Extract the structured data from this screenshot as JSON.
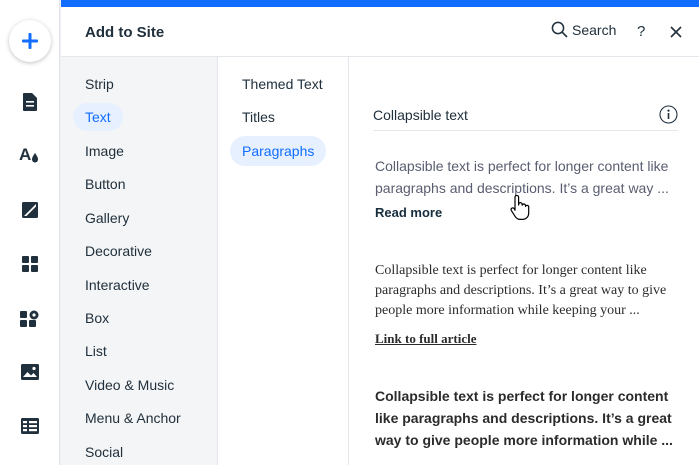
{
  "colors": {
    "accent": "#116dff",
    "active_bg": "#e7f0ff",
    "text": "#20303c"
  },
  "rail": {
    "icons": [
      "add-icon",
      "pages-icon",
      "design-icon",
      "background-icon",
      "apps-icon",
      "business-icon",
      "media-icon",
      "cms-icon"
    ]
  },
  "header": {
    "title": "Add to Site",
    "search_label": "Search",
    "help_label": "?"
  },
  "categories": [
    "Strip",
    "Text",
    "Image",
    "Button",
    "Gallery",
    "Decorative",
    "Interactive",
    "Box",
    "List",
    "Video & Music",
    "Menu & Anchor",
    "Social"
  ],
  "active_category": "Text",
  "subcategories": [
    "Themed Text",
    "Titles",
    "Paragraphs"
  ],
  "active_subcategory": "Paragraphs",
  "content": {
    "section_title": "Collapsible text",
    "items": [
      {
        "body": "Collapsible text is perfect for longer content like paragraphs and descriptions. It’s a great way ...",
        "link": "Read more"
      },
      {
        "body": "Collapsible text is perfect for longer content like paragraphs and descriptions. It’s a great way to give people more information while keeping your ...",
        "link": "Link to full article"
      },
      {
        "body": "Collapsible text is perfect for longer content like paragraphs and descriptions. It’s a great way to give people more information while ..."
      }
    ]
  }
}
